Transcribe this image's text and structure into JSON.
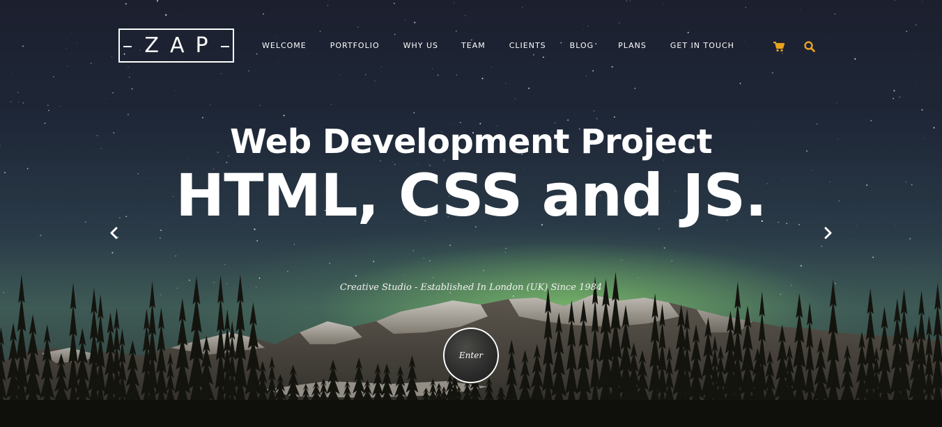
{
  "brand": {
    "logo_text": "ZAP"
  },
  "nav": {
    "items": [
      {
        "label": "WELCOME"
      },
      {
        "label": "PORTFOLIO"
      },
      {
        "label": "WHY US"
      },
      {
        "label": "TEAM"
      },
      {
        "label": "CLIENTS"
      },
      {
        "label": "BLOG"
      },
      {
        "label": "PLANS"
      },
      {
        "label": "GET IN TOUCH"
      }
    ],
    "icons": [
      "shopping-cart-icon",
      "search-icon"
    ],
    "accent_color": "#e8a321"
  },
  "hero": {
    "headline": "Web Development Project",
    "subheadline": "HTML, CSS and JS.",
    "tagline": "Creative Studio - Established In London (UK) Since 1984",
    "enter_label": "Enter",
    "prev_icon": "chevron-left-icon",
    "next_icon": "chevron-right-icon"
  }
}
